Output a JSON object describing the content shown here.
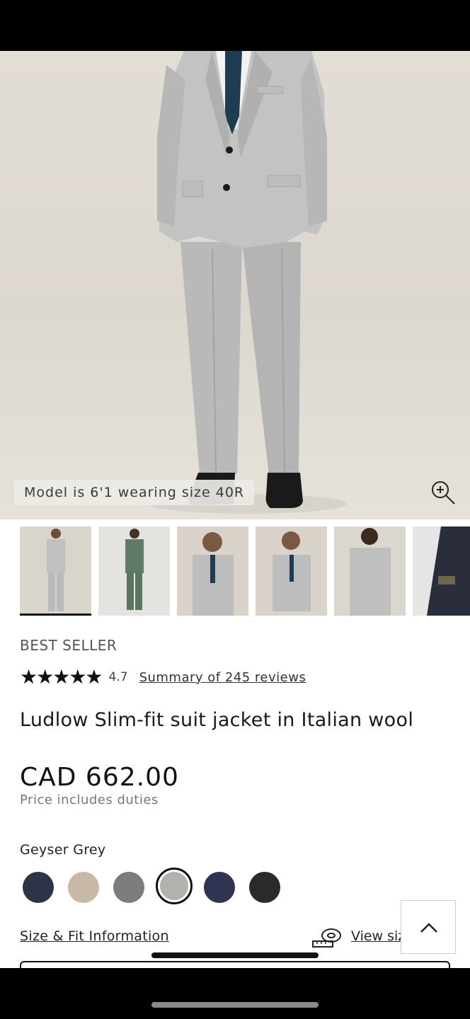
{
  "hero": {
    "model_caption": "Model is 6'1 wearing size 40R",
    "zoom_icon": "zoom-in-icon"
  },
  "thumbnails": [
    {
      "name": "thumb-full-grey",
      "active": true
    },
    {
      "name": "thumb-full-green",
      "active": false
    },
    {
      "name": "thumb-upper-front",
      "active": false
    },
    {
      "name": "thumb-upper-side",
      "active": false
    },
    {
      "name": "thumb-back",
      "active": false
    },
    {
      "name": "thumb-lining",
      "active": false
    }
  ],
  "product": {
    "badge": "BEST SELLER",
    "stars": "★★★★★",
    "rating": "4.7",
    "reviews_link": "Summary of 245 reviews",
    "title": "Ludlow Slim-fit suit jacket in Italian wool",
    "price": "CAD 662.00",
    "price_note": "Price includes duties"
  },
  "colors": {
    "selected_name": "Geyser Grey",
    "swatches": [
      {
        "hex": "#2e3447",
        "selected": false
      },
      {
        "hex": "#c7b8a8",
        "selected": false
      },
      {
        "hex": "#7b7c7d",
        "selected": false
      },
      {
        "hex": "#b3b1ac",
        "selected": true
      },
      {
        "hex": "#2f3452",
        "selected": false
      },
      {
        "hex": "#2a2a2a",
        "selected": false
      }
    ]
  },
  "links": {
    "size_fit": "Size & Fit Information",
    "view_size": "View size chart"
  },
  "icons": {
    "tape": "measuring-tape-icon",
    "scroll_top": "chevron-up-icon"
  }
}
